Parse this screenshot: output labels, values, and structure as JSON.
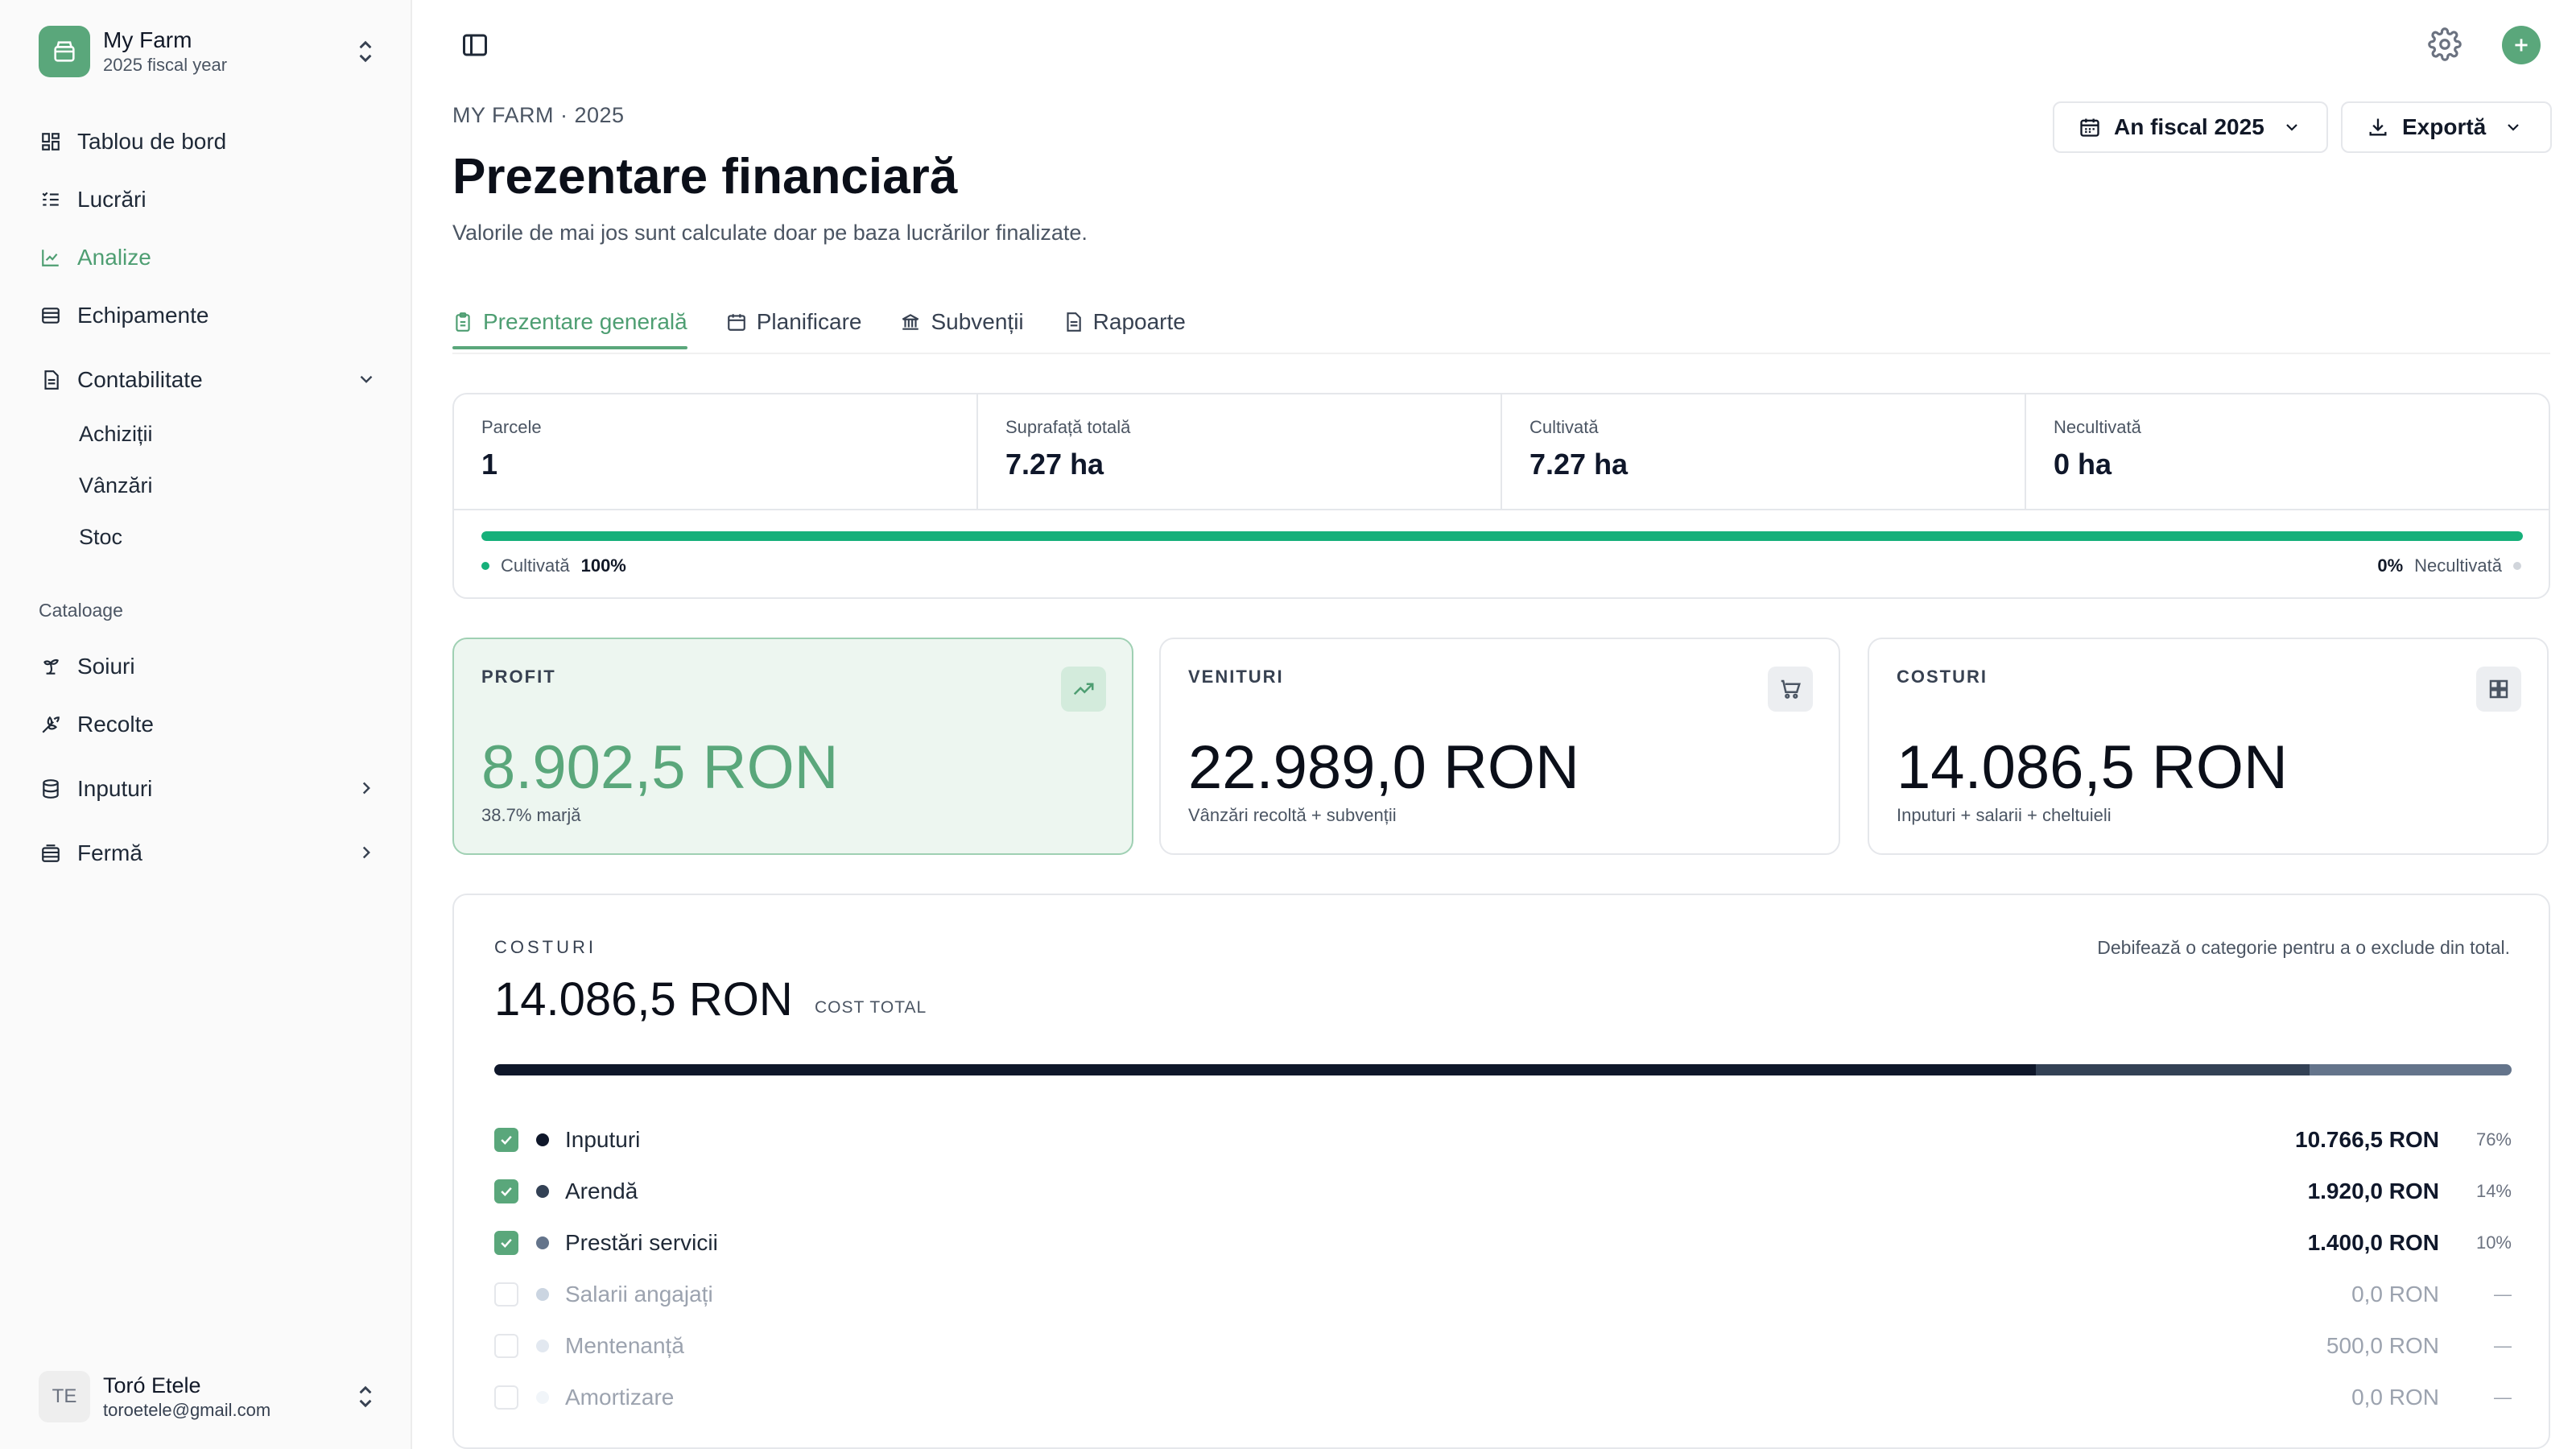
{
  "farm": {
    "name": "My Farm",
    "sub": "2025 fiscal year"
  },
  "nav": {
    "dashboard": "Tablou de bord",
    "works": "Lucrări",
    "analytics": "Analize",
    "equipment": "Echipamente",
    "accounting": "Contabilitate",
    "acquisitions": "Achiziții",
    "sales": "Vânzări",
    "stock": "Stoc",
    "catalogs_label": "Cataloage",
    "varieties": "Soiuri",
    "harvests": "Recolte",
    "inputs": "Inputuri",
    "farm": "Fermă"
  },
  "user": {
    "initials": "TE",
    "name": "Toró Etele",
    "email": "toroetele@gmail.com"
  },
  "header": {
    "breadcrumb": "MY FARM · 2025",
    "title": "Prezentare financiară",
    "description": "Valorile de mai jos sunt calculate doar pe baza lucrărilor finalizate.",
    "fiscal_button": "An fiscal 2025",
    "export_button": "Exportă"
  },
  "tabs": [
    "Prezentare generală",
    "Planificare",
    "Subvenții",
    "Rapoarte"
  ],
  "stats": {
    "parcels_label": "Parcele",
    "parcels_value": "1",
    "area_label": "Suprafață totală",
    "area_value": "7.27 ha",
    "cultivated_label": "Cultivată",
    "cultivated_value": "7.27 ha",
    "uncultivated_label": "Necultivată",
    "uncultivated_value": "0 ha",
    "cultivated_fraction": 1.0,
    "legend_left_label": "Cultivată",
    "legend_left_pct": "100%",
    "legend_right_pct": "0%",
    "legend_right_label": "Necultivată"
  },
  "kpis": {
    "profit": {
      "label": "PROFIT",
      "value": "8.902,5 RON",
      "sub": "38.7% marjă"
    },
    "revenue": {
      "label": "VENITURI",
      "value": "22.989,0 RON",
      "sub": "Vânzări recoltă + subvenții"
    },
    "costs": {
      "label": "COSTURI",
      "value": "14.086,5 RON",
      "sub": "Inputuri + salarii + cheltuieli"
    }
  },
  "costs": {
    "label": "COSTURI",
    "hint": "Debifează o categorie pentru a o exclude din total.",
    "total": "14.086,5 RON",
    "total_label": "COST TOTAL",
    "rows": [
      {
        "name": "Inputuri",
        "amount": "10.766,5 RON",
        "pct": "76%",
        "checked": true,
        "color": "#0f172a",
        "share": 0.764
      },
      {
        "name": "Arendă",
        "amount": "1.920,0 RON",
        "pct": "14%",
        "checked": true,
        "color": "#334155",
        "share": 0.136
      },
      {
        "name": "Prestări servicii",
        "amount": "1.400,0 RON",
        "pct": "10%",
        "checked": true,
        "color": "#64748b",
        "share": 0.1
      },
      {
        "name": "Salarii angajați",
        "amount": "0,0 RON",
        "pct": "—",
        "checked": false,
        "color": "#cbd5e1",
        "share": 0
      },
      {
        "name": "Mentenanță",
        "amount": "500,0 RON",
        "pct": "—",
        "checked": false,
        "color": "#e2e8f0",
        "share": 0
      },
      {
        "name": "Amortizare",
        "amount": "0,0 RON",
        "pct": "—",
        "checked": false,
        "color": "#f1f5f9",
        "share": 0
      }
    ]
  },
  "colors": {
    "accent": "#5aa77b",
    "progress": "#16b07a"
  }
}
